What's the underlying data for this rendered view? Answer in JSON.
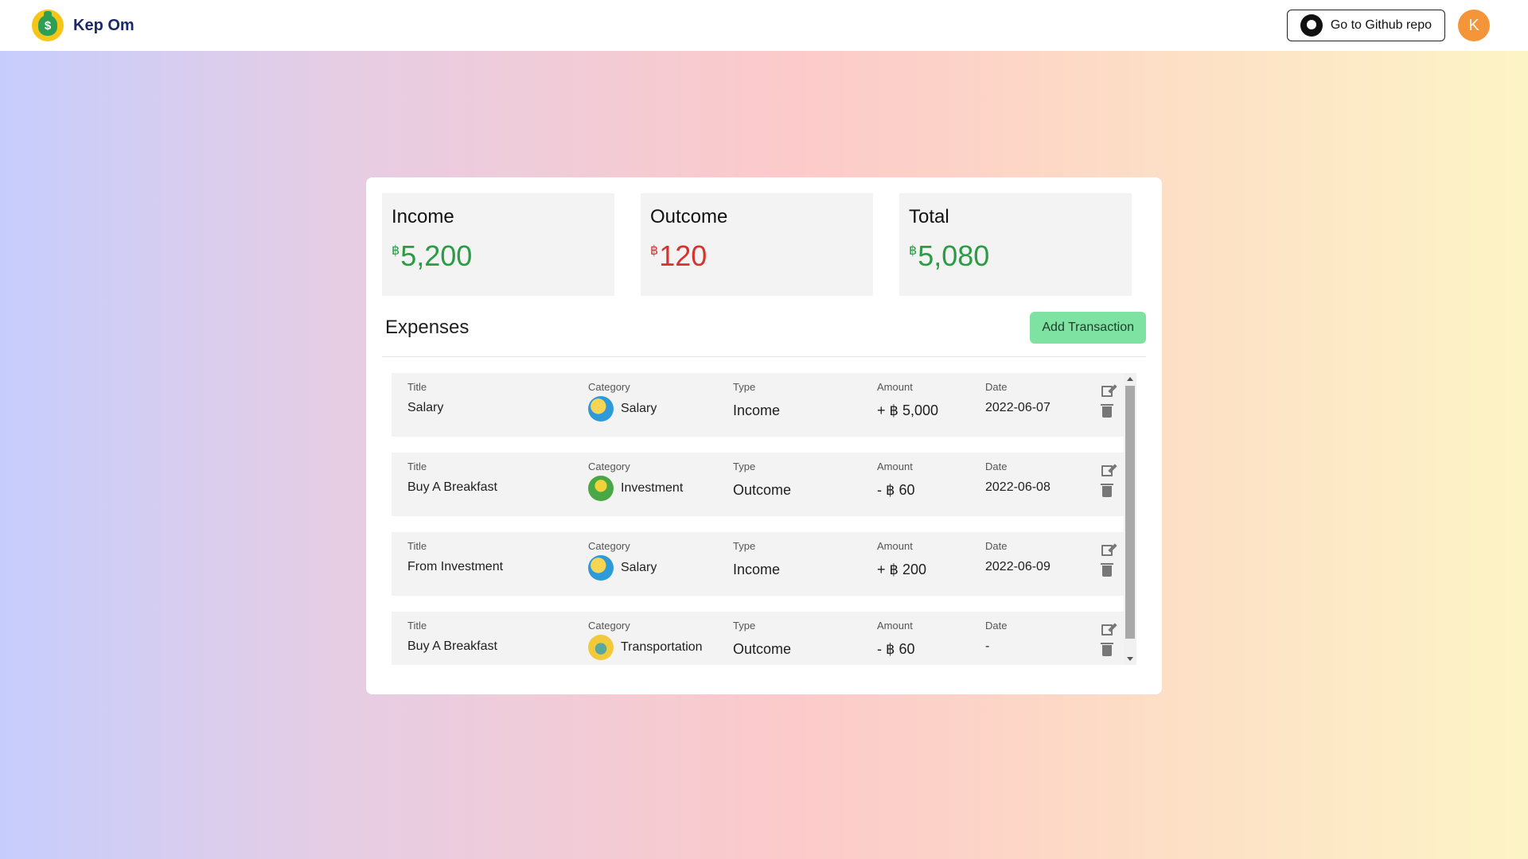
{
  "header": {
    "brand": "Kep Om",
    "brand_icon": "money-bag-icon",
    "github_label": "Go to Github repo",
    "github_icon": "github-icon",
    "avatar_initial": "K"
  },
  "stats": {
    "income": {
      "title": "Income",
      "currency": "฿",
      "value": "5,200"
    },
    "outcome": {
      "title": "Outcome",
      "currency": "฿",
      "value": "120"
    },
    "total": {
      "title": "Total",
      "currency": "฿",
      "value": "5,080"
    }
  },
  "expenses": {
    "title": "Expenses",
    "add_label": "Add Transaction",
    "columns": {
      "title": "Title",
      "category": "Category",
      "type": "Type",
      "amount": "Amount",
      "date": "Date"
    },
    "rows": [
      {
        "title": "Salary",
        "category": "Salary",
        "type": "Income",
        "amount": "+ ฿ 5,000",
        "date": "2022-06-07"
      },
      {
        "title": "Buy A Breakfast",
        "category": "Investment",
        "type": "Outcome",
        "amount": "- ฿ 60",
        "date": "2022-06-08"
      },
      {
        "title": "From Investment",
        "category": "Salary",
        "type": "Income",
        "amount": "+ ฿ 200",
        "date": "2022-06-09"
      },
      {
        "title": "Buy A Breakfast",
        "category": "Transportation",
        "type": "Outcome",
        "amount": "- ฿ 60",
        "date": "-"
      }
    ]
  },
  "colors": {
    "income": "#2b9b45",
    "outcome": "#d6332e",
    "add_button": "#7ee3a2",
    "avatar": "#f5953a"
  }
}
